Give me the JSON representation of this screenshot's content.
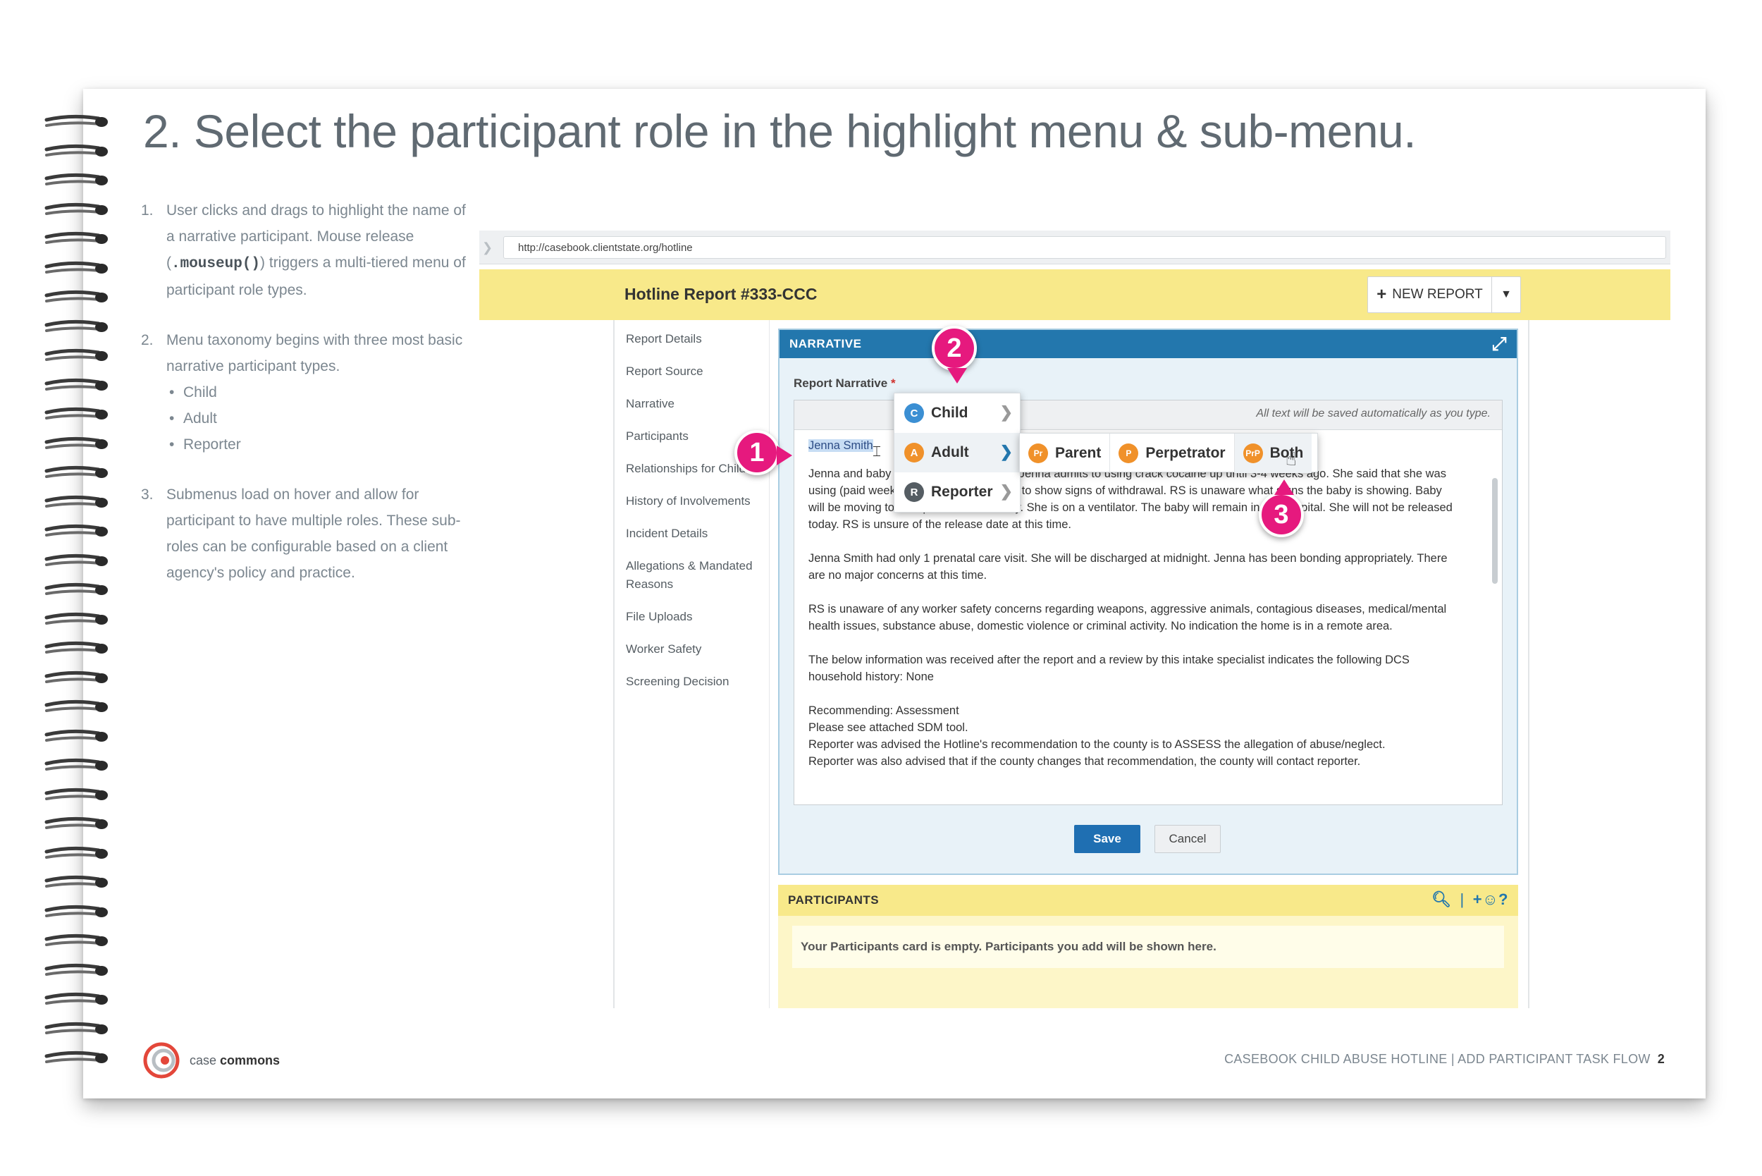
{
  "slide": {
    "title": "2. Select the participant role in the highlight menu & sub-menu.",
    "steps": [
      {
        "num": "1.",
        "text_before": "User clicks and drags to highlight the name of a narrative participant. Mouse release (",
        "code": ".mouseup()",
        "text_after": ") triggers a multi-tiered menu of participant role types."
      },
      {
        "num": "2.",
        "text": "Menu taxonomy begins with three most basic narrative participant types.",
        "bullets": [
          "Child",
          "Adult",
          "Reporter"
        ]
      },
      {
        "num": "3.",
        "text": "Submenus load on hover and allow for participant to have multiple roles. These sub-roles can be configurable based on a client agency's policy and practice."
      }
    ]
  },
  "browser": {
    "url": "http://casebook.clientstate.org/hotline"
  },
  "app": {
    "report_title": "Hotline Report #333-CCC",
    "new_report_label": "NEW REPORT",
    "sidenav": [
      "Report Details",
      "Report Source",
      "Narrative",
      "Participants",
      "Relationships for Children",
      "History of Involvements",
      "Incident Details",
      "Allegations & Mandated Reasons",
      "File Uploads",
      "Worker Safety",
      "Screening Decision"
    ],
    "narrative": {
      "header": "NARRATIVE",
      "label": "Report Narrative",
      "required_mark": "*",
      "autosave_note": "All text will be saved automatically as you type.",
      "highlighted_name": "Jenna Smith",
      "paragraphs": [
        "Jenna and baby tested positive for THC. Jenna admits to using crack cocaine up until 3-4 weeks ago. She said that she was using (paid weekly). Baby is now starting to show signs of withdrawal. RS is unaware what signs the baby is showing. Baby will be moving to the special care nursery. She is on a ventilator. The baby will remain in the hospital. She will not be released today. RS is unsure of the release date at this time.",
        "Jenna Smith had only 1 prenatal care visit. She will be discharged at midnight. Jenna has been bonding appropriately. There are no major concerns at this time.",
        "RS is unaware of any worker safety concerns regarding weapons, aggressive animals, contagious diseases, medical/mental health issues, substance abuse, domestic violence or criminal activity. No indication the home is in a remote area.",
        "The below information was received after the report and a review by this intake specialist indicates the following DCS household history: None",
        "Recommending: Assessment",
        "Please see attached SDM tool.",
        "Reporter was advised the Hotline's recommendation to the county is to ASSESS the allegation of abuse/neglect.",
        "Reporter was also advised that if the county changes that recommendation, the county will contact reporter."
      ],
      "save_label": "Save",
      "cancel_label": "Cancel"
    },
    "menu": {
      "items": [
        {
          "badge": "C",
          "label": "Child"
        },
        {
          "badge": "A",
          "label": "Adult"
        },
        {
          "badge": "R",
          "label": "Reporter"
        }
      ],
      "submenu": [
        {
          "badge": "Pr",
          "label": "Parent"
        },
        {
          "badge": "P",
          "label": "Perpetrator"
        },
        {
          "badge": "PrP",
          "label": "Both"
        }
      ]
    },
    "participants": {
      "header": "PARTICIPANTS",
      "empty_text": "Your Participants card is empty. Participants you add will be shown here."
    }
  },
  "callouts": [
    "1",
    "2",
    "3"
  ],
  "footer": {
    "logo_case": "case",
    "logo_commons": "commons",
    "text": "CASEBOOK CHILD ABUSE HOTLINE | ADD PARTICIPANT TASK FLOW",
    "page": "2"
  },
  "colors": {
    "accent_blue": "#2377ad",
    "callout_pink": "#e6197e",
    "header_yellow": "#f8e98a",
    "adult_orange": "#f0912a"
  }
}
